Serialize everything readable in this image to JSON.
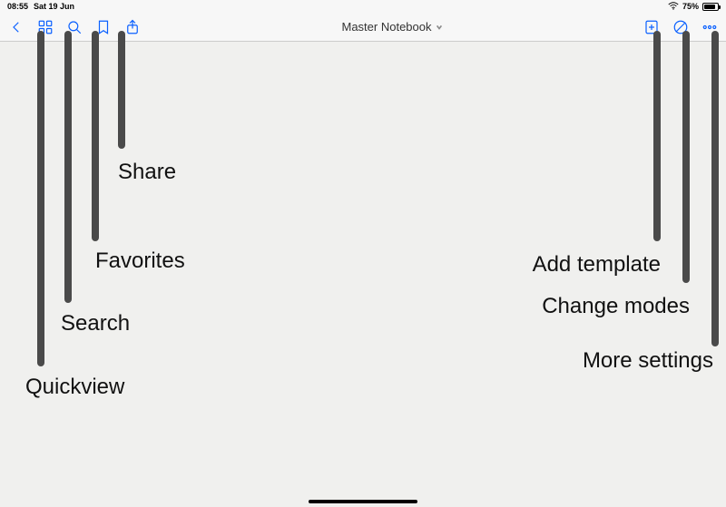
{
  "status": {
    "time": "08:55",
    "date": "Sat 19 Jun",
    "battery_pct": "75%"
  },
  "toolbar": {
    "title": "Master Notebook"
  },
  "callouts": {
    "share": "Share",
    "favorites": "Favorites",
    "search": "Search",
    "quickview": "Quickview",
    "add_template": "Add template",
    "change_modes": "Change modes",
    "more_settings": "More settings"
  }
}
